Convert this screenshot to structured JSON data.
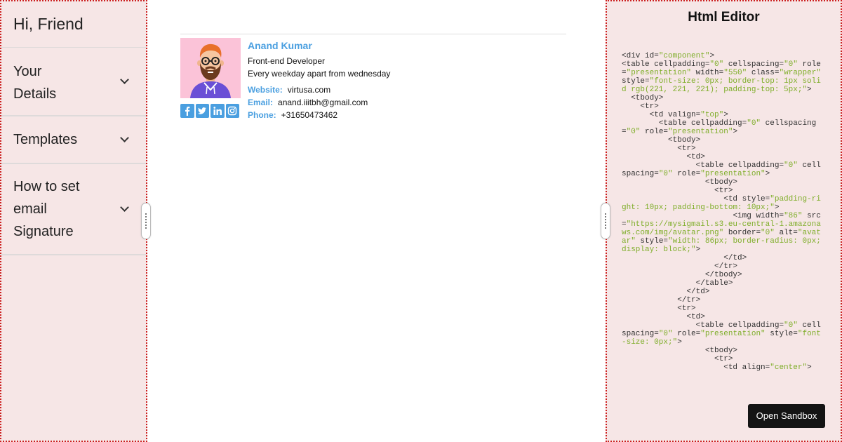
{
  "sidebar": {
    "greeting": "Hi, Friend",
    "sections": [
      {
        "label_line1": "Your",
        "label_line2": "Details"
      },
      {
        "label": "Templates"
      },
      {
        "label_line1": "How to set",
        "label_line2": "email",
        "label_line3": "Signature"
      }
    ]
  },
  "signature": {
    "name": "Anand Kumar",
    "role": "Front-end Developer",
    "hours": "Every weekday apart from wednesday",
    "website_label": "Website:",
    "website": "virtusa.com",
    "email_label": "Email:",
    "email": "anand.iiitbh@gmail.com",
    "phone_label": "Phone:",
    "phone": "+31650473462",
    "socials": [
      "facebook-icon",
      "twitter-icon",
      "linkedin-icon",
      "instagram-icon"
    ],
    "accent_color": "#4a9fe0"
  },
  "editor": {
    "title": "Html Editor",
    "open_sandbox": "Open Sandbox"
  },
  "colors": {
    "panel_bg": "#f6e6e6",
    "panel_border": "#cc1f1f",
    "code_string": "#7fae2a"
  }
}
